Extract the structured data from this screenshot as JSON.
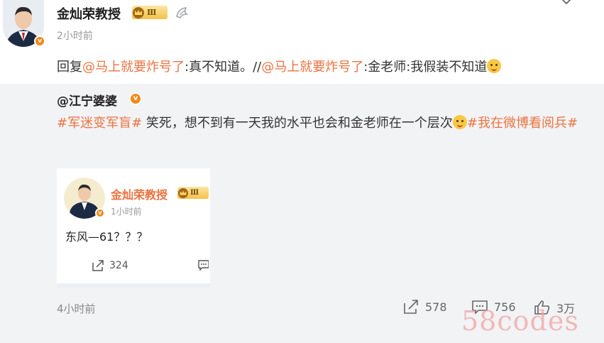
{
  "post": {
    "author": "金灿荣教授",
    "level_badge": "Ⅲ",
    "time": "2小时前",
    "reply_prefix": "回复",
    "mention1": "@马上就要炸号了",
    "reply_text1": ":真不知道。//",
    "mention2": "@马上就要炸号了",
    "reply_text2": ":金老师:我假装不知道"
  },
  "repost": {
    "author": "@江宁婆婆",
    "hashtag1": "#军迷变军盲#",
    "text": " 笑死，想不到有一天我的水平也会和金老师在一个层次",
    "hashtag2": "#我在微博看阅兵#"
  },
  "card": {
    "author": "金灿荣教授",
    "level_badge": "Ⅲ",
    "time": "1小时前",
    "text": "东风—61？？？",
    "share_count": "324"
  },
  "footer": {
    "time": "4小时前",
    "repost_count": "578",
    "comment_count": "756",
    "like_count": "3万"
  },
  "watermark": "58codes",
  "colors": {
    "accent": "#eb7340",
    "verified": "#f08a1a",
    "repost_bg": "#f2f3f5"
  }
}
